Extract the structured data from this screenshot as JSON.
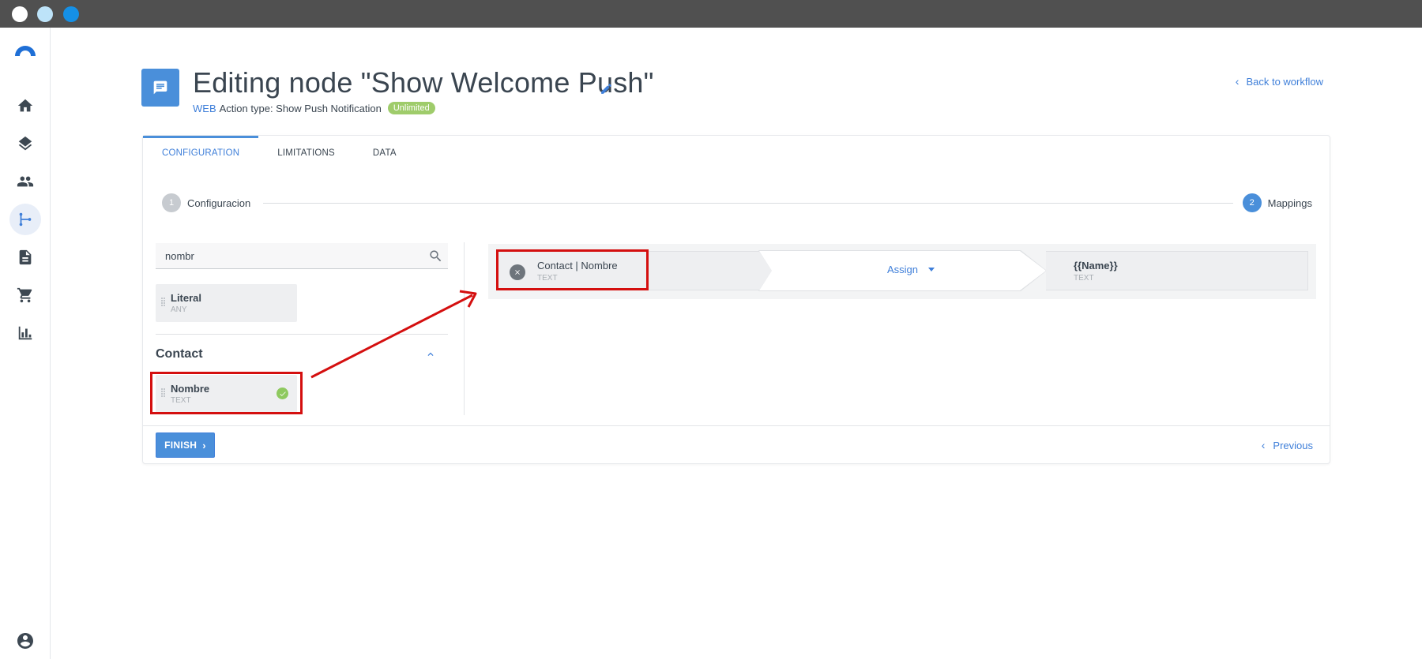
{
  "window": {
    "controls": [
      "close",
      "minimize",
      "maximize"
    ]
  },
  "sidebar": {
    "logo": "brand-logo",
    "items": [
      {
        "name": "home",
        "icon": "home-icon"
      },
      {
        "name": "layers",
        "icon": "layers-icon"
      },
      {
        "name": "contacts",
        "icon": "people-icon"
      },
      {
        "name": "workflows",
        "icon": "workflow-icon",
        "active": true
      },
      {
        "name": "documents",
        "icon": "document-icon"
      },
      {
        "name": "commerce",
        "icon": "cart-icon"
      },
      {
        "name": "reports",
        "icon": "bar-chart-icon"
      }
    ],
    "profile_icon": "account-circle-icon"
  },
  "header": {
    "title": "Editing node \"Show Welcome Push\"",
    "channel": "WEB",
    "action_type": "Action type: Show Push Notification",
    "badge": "Unlimited",
    "back_link": "Back to workflow"
  },
  "tabs": [
    {
      "label": "CONFIGURATION",
      "active": true
    },
    {
      "label": "LIMITATIONS",
      "active": false
    },
    {
      "label": "DATA",
      "active": false
    }
  ],
  "stepper": {
    "steps": [
      {
        "number": "1",
        "label": "Configuracion"
      },
      {
        "number": "2",
        "label": "Mappings",
        "active": true
      }
    ]
  },
  "left_panel": {
    "search_value": "nombr",
    "literal": {
      "title": "Literal",
      "type": "ANY"
    },
    "group": {
      "title": "Contact",
      "fields": [
        {
          "title": "Nombre",
          "type": "TEXT",
          "mapped": true
        }
      ]
    }
  },
  "mapping": {
    "source": {
      "title": "Contact | Nombre",
      "type": "TEXT"
    },
    "operation": "Assign",
    "target": {
      "title": "{{Name}}",
      "type": "TEXT"
    }
  },
  "footer": {
    "finish_label": "FINISH",
    "previous_label": "Previous"
  },
  "colors": {
    "accent": "#3f7fd9",
    "primary_button": "#4a8fda",
    "badge": "#9fcc6b",
    "annotation": "#d40f0f"
  }
}
